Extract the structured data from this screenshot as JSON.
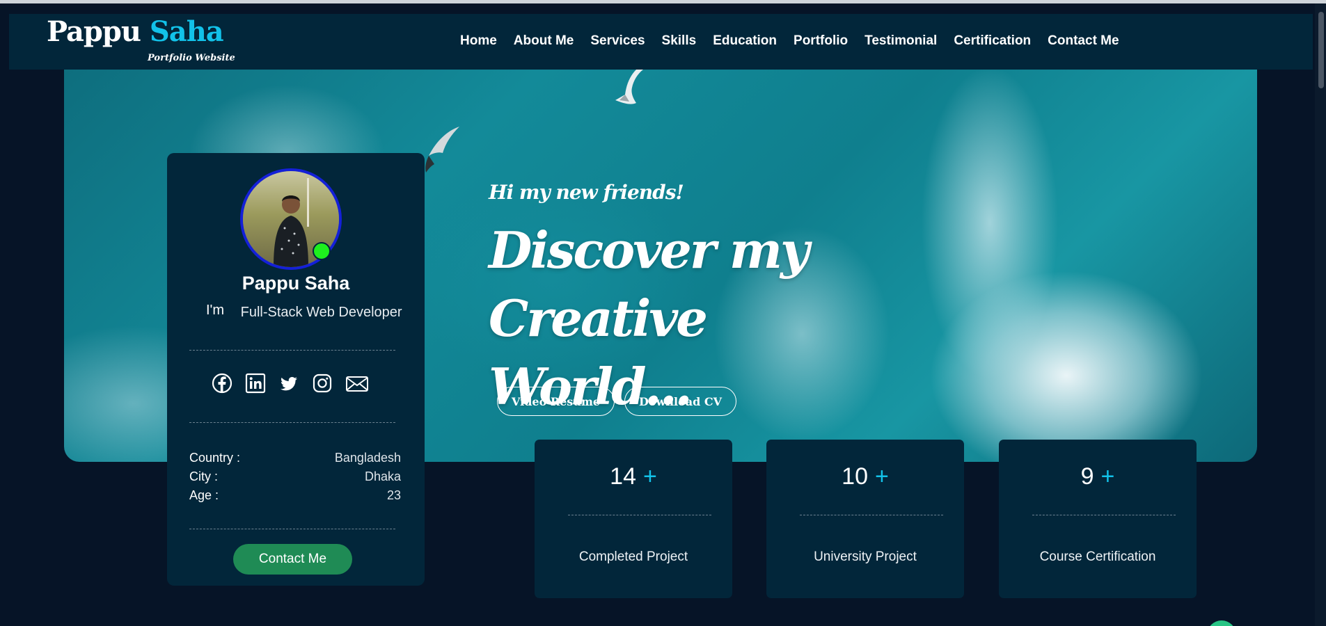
{
  "brand": {
    "first": "Pappu",
    "last": "Saha",
    "subtitle": "Portfolio Website",
    "accent_color": "#12c2e9"
  },
  "nav": [
    {
      "label": "Home"
    },
    {
      "label": "About Me"
    },
    {
      "label": "Services"
    },
    {
      "label": "Skills"
    },
    {
      "label": "Education"
    },
    {
      "label": "Portfolio"
    },
    {
      "label": "Testimonial"
    },
    {
      "label": "Certification"
    },
    {
      "label": "Contact Me"
    }
  ],
  "hero": {
    "greeting": "Hi my new friends!",
    "headline": "Discover my Creative World...",
    "buttons": {
      "video_resume": "Video Resume",
      "download_cv": "Download CV"
    }
  },
  "profile": {
    "name": "Pappu Saha",
    "prefix": "I'm",
    "role": "Full-Stack Web Developer",
    "online_color": "#1ef01e",
    "socials": [
      {
        "icon": "facebook-icon"
      },
      {
        "icon": "linkedin-icon"
      },
      {
        "icon": "twitter-icon"
      },
      {
        "icon": "instagram-icon"
      },
      {
        "icon": "email-icon"
      }
    ],
    "info": [
      {
        "label": "Country :",
        "value": "Bangladesh"
      },
      {
        "label": "City :",
        "value": "Dhaka"
      },
      {
        "label": "Age :",
        "value": "23"
      }
    ],
    "contact_label": "Contact Me",
    "contact_color": "#1f8b55"
  },
  "stats": [
    {
      "number": "14",
      "plus": "+",
      "label": "Completed Project"
    },
    {
      "number": "10",
      "plus": "+",
      "label": "University Project"
    },
    {
      "number": "9",
      "plus": "+",
      "label": "Course Certification"
    }
  ]
}
